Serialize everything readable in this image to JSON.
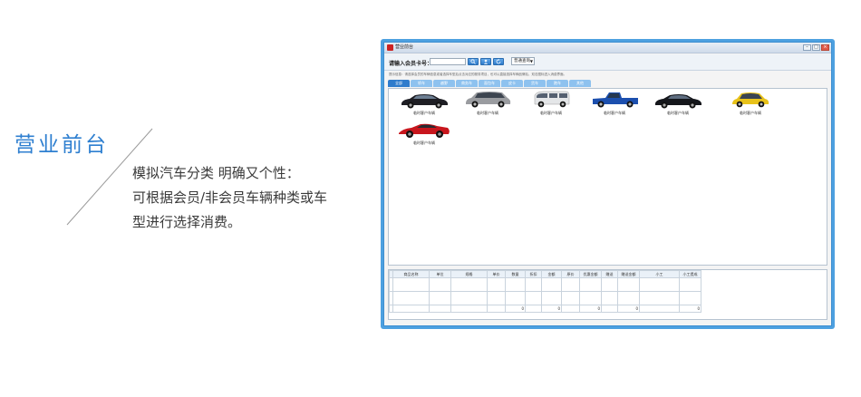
{
  "promo": {
    "title": "营业前台",
    "line1": "模拟汽车分类  明确又个性：",
    "line2": "可根据会员/非会员车辆种类或车",
    "line3": "型进行选择消费。"
  },
  "window": {
    "title": "营业前台",
    "search_label": "请输入会员卡号：",
    "search_value": "",
    "query_select": "普通查询"
  },
  "hint": "提示信息：请选择会员的车辆信息或者选择车型后点击对应的服务项目，也可以直接选择车辆品牌后，双击图标进入消费界面。",
  "tabs": [
    "全部",
    "轿车",
    "越野",
    "商务车",
    "面包车",
    "皮卡",
    "货车",
    "跑车",
    "其他"
  ],
  "cars": [
    {
      "label": "临时客户车辆"
    },
    {
      "label": "临时客户车辆"
    },
    {
      "label": "临时客户车辆"
    },
    {
      "label": "临时客户车辆"
    },
    {
      "label": "临时客户车辆"
    },
    {
      "label": "临时客户车辆"
    },
    {
      "label": "临时客户车辆"
    }
  ],
  "table": {
    "columns": [
      "",
      "商品名称",
      "单位",
      "规格",
      "单价",
      "数量",
      "折扣",
      "金额",
      "原价",
      "优惠金额",
      "赠送",
      "赠送金额",
      "小工",
      "小工提成"
    ],
    "totals": [
      "",
      "",
      "",
      "",
      "",
      "0",
      "",
      "0",
      "",
      "0",
      "",
      "0",
      "",
      "0"
    ]
  }
}
